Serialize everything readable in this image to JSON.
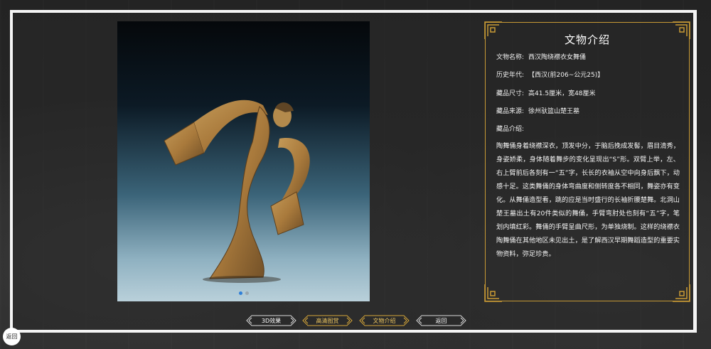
{
  "panel": {
    "title": "文物介绍",
    "fields": [
      {
        "label": "文物名称:",
        "value": "西汉陶绕襟衣女舞俑"
      },
      {
        "label": "历史年代:",
        "value": "【西汉(前206~公元25)】"
      },
      {
        "label": "藏品尺寸:",
        "value": "高41.5厘米，宽48厘米"
      },
      {
        "label": "藏品来源:",
        "value": "徐州驮篮山楚王墓"
      },
      {
        "label": "藏品介绍:",
        "value": ""
      }
    ],
    "description": "陶舞俑身着绕襟深衣，顶发中分，于脑后挽成发髻，眉目清秀，身姿娇柔，身体随着舞步的变化呈现出“S”形。双臂上举，左、右上臂前后各刻有一“五”字，长长的衣袖从空中向身后飘下，动感十足。这类舞俑的身体弯曲度和侧转度各不相同，舞姿亦有变化。从舞俑造型看，跳的应是当时盛行的长袖折腰楚舞。北洞山楚王墓出土有20件类似的舞俑，手臂弯肘处也刻有“五”字，笔划内填红彩。舞俑的手臂呈曲尺形，为单独烧制。这样的绕襟衣陶舞俑在其他地区未见出土，是了解西汉早期舞蹈造型的重要实物资料，弥足珍贵。"
  },
  "buttons": [
    {
      "label": "3D效果",
      "style": "silver"
    },
    {
      "label": "高清图赏",
      "style": "gold"
    },
    {
      "label": "文物介绍",
      "style": "gold"
    },
    {
      "label": "返回",
      "style": "silver"
    }
  ],
  "back_corner": "返回",
  "carousel": {
    "count": 2,
    "active": 1
  },
  "colors": {
    "accent_gold": "#c89a35",
    "frame": "#f4f4f4",
    "dot_active": "#2f7fd8"
  },
  "icons": [
    "corner-ornament-icon",
    "button-frame-icon"
  ]
}
